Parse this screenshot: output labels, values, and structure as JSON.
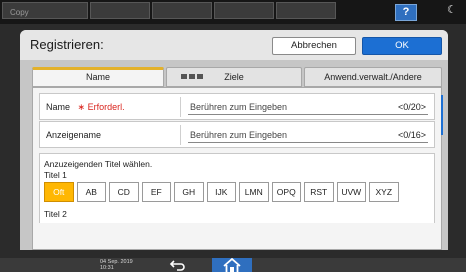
{
  "topbar": {
    "app_label": "Copy",
    "help_label": "?",
    "night_icon": "crescent-moon-icon"
  },
  "dialog": {
    "title": "Registrieren:",
    "cancel_label": "Abbrechen",
    "ok_label": "OK"
  },
  "tabs": [
    {
      "label": "Name",
      "active": true
    },
    {
      "label": "Ziele",
      "active": false,
      "icon": "destination-icon"
    },
    {
      "label": "Anwend.verwalt./Andere",
      "active": false
    }
  ],
  "fields": [
    {
      "label": "Name",
      "required_label": "∗ Erforderl.",
      "placeholder": "Berühren zum Eingeben",
      "counter": "<0/20>"
    },
    {
      "label": "Anzeigename",
      "placeholder": "Berühren zum Eingeben",
      "counter": "<0/16>"
    }
  ],
  "title_select": {
    "prompt": "Anzuzeigenden Titel wählen.",
    "title1_label": "Titel 1",
    "title2_label": "Titel 2",
    "keys": [
      "Oft",
      "AB",
      "CD",
      "EF",
      "GH",
      "IJK",
      "LMN",
      "OPQ",
      "RST",
      "UVW",
      "XYZ"
    ],
    "selected": "Oft"
  },
  "bottombar": {
    "date": "04 Sep. 2019",
    "time": "10:31"
  },
  "colors": {
    "accent_blue": "#1c6fd3",
    "tab_active_underline": "#e3b12a",
    "key_selected": "#ffb703",
    "required": "#d9241d"
  }
}
